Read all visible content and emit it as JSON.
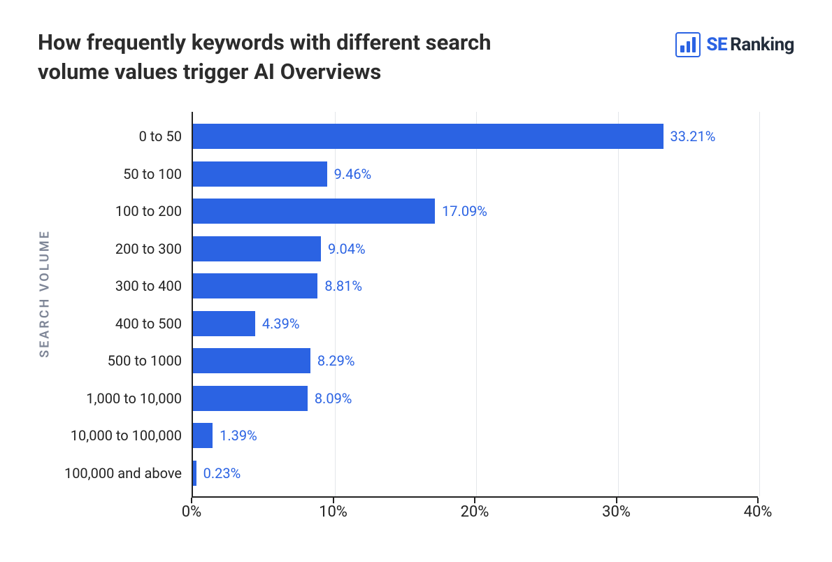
{
  "header": {
    "title": "How frequently keywords with different search volume values trigger AI Overviews",
    "brand_se": "SE",
    "brand_ranking": "Ranking"
  },
  "chart_data": {
    "type": "bar",
    "orientation": "horizontal",
    "title": "How frequently keywords with different search volume values trigger AI Overviews",
    "ylabel": "SEARCH VOLUME",
    "xlabel": "",
    "xlim": [
      0,
      40
    ],
    "x_ticks": [
      0,
      10,
      20,
      30,
      40
    ],
    "x_tick_labels": [
      "0%",
      "10%",
      "20%",
      "30%",
      "40%"
    ],
    "categories": [
      "0 to 50",
      "50 to 100",
      "100 to 200",
      "200 to 300",
      "300 to 400",
      "400 to 500",
      "500 to 1000",
      "1,000 to 10,000",
      "10,000 to 100,000",
      "100,000 and above"
    ],
    "values": [
      33.21,
      9.46,
      17.09,
      9.04,
      8.81,
      4.39,
      8.29,
      8.09,
      1.39,
      0.23
    ],
    "value_labels": [
      "33.21%",
      "9.46%",
      "17.09%",
      "9.04%",
      "8.81%",
      "4.39%",
      "8.29%",
      "8.09%",
      "1.39%",
      "0.23%"
    ],
    "bar_color": "#2b63e3"
  }
}
